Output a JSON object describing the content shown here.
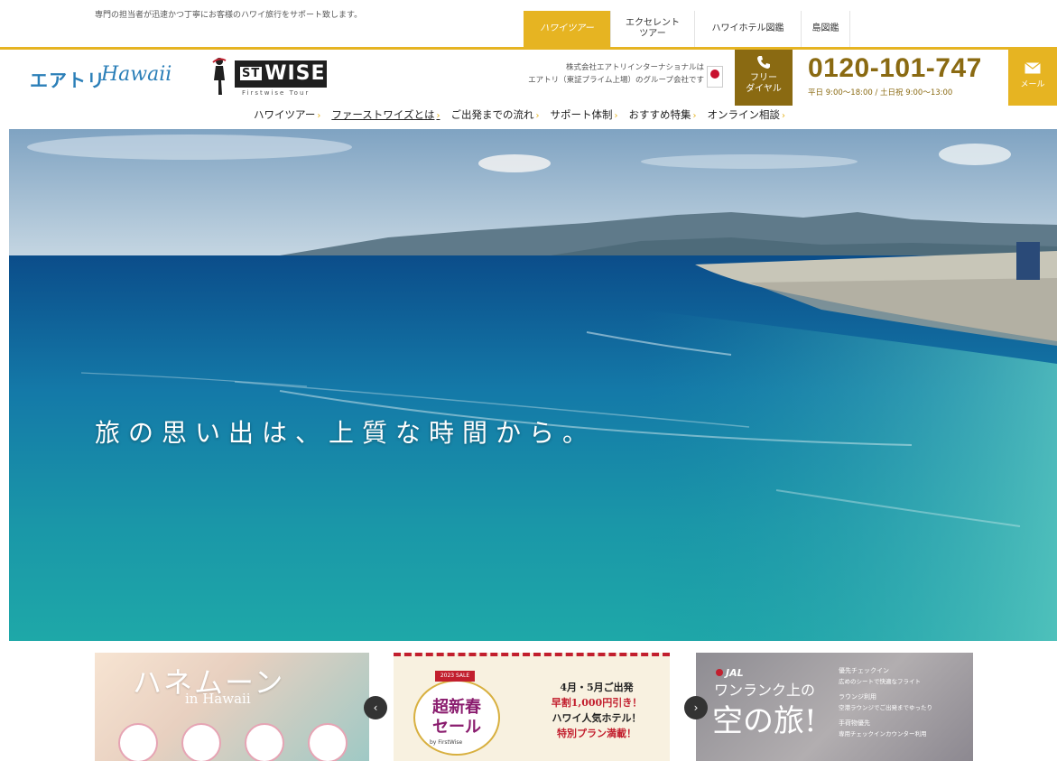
{
  "topbar": {
    "tagline": "専門の担当者が迅速かつ丁寧にお客様のハワイ旅行をサポート致します。",
    "tabs": [
      {
        "label": "ハワイツアー",
        "active": true
      },
      {
        "label": "エクセレント\nツアー",
        "active": false
      },
      {
        "label": "ハワイホテル図鑑",
        "active": false
      },
      {
        "label": "島図鑑",
        "active": false
      }
    ]
  },
  "header": {
    "brand": {
      "text_a": "エアトリ",
      "text_b": "Hawaii"
    },
    "logo2": {
      "st": "ST",
      "wise": "WISE",
      "sub": "Firstwise Tour"
    },
    "company_line1": "株式会社エアトリインターナショナルは",
    "company_line2": "エアトリ（東証プライム上場）のグループ会社です",
    "freedial_label": "フリー\nダイヤル",
    "phone": "0120-101-747",
    "hours": "平日 9:00〜18:00 / 土日祝 9:00〜13:00",
    "mail_label": "メール"
  },
  "mainnav": [
    {
      "label": "ハワイツアー",
      "active": false
    },
    {
      "label": "ファーストワイズとは",
      "active": true
    },
    {
      "label": "ご出発までの流れ",
      "active": false
    },
    {
      "label": "サポート体制",
      "active": false
    },
    {
      "label": "おすすめ特集",
      "active": false
    },
    {
      "label": "オンライン相談",
      "active": false
    }
  ],
  "hero": {
    "copy": "旅の思い出は、上質な時間から。"
  },
  "carousel": {
    "prev": "‹",
    "next": "›",
    "banner1": {
      "title": "ハネムーン",
      "sub": "in Hawaii"
    },
    "banner2": {
      "tag": "2023 SALE",
      "main": "超新春\nセール",
      "note": "by FirstWise",
      "line1": "4月・5月ご出発",
      "line2": "早割1,000円引き！",
      "line3": "ハワイ人気ホテル！",
      "line4": "特別プラン満載！"
    },
    "banner3": {
      "logo": "JAL",
      "title": "ワンランク上の",
      "big": "空の旅!",
      "items": [
        {
          "head": "優先チェックイン",
          "text": "広めのシートで快適なフライト"
        },
        {
          "head": "ラウンジ利用",
          "text": "空港ラウンジでご出発までゆったり"
        },
        {
          "head": "手荷物優先",
          "text": "専用チェックインカウンター利用"
        }
      ]
    }
  },
  "colors": {
    "gold": "#e6b422",
    "brown": "#8a6a12",
    "brand_blue": "#2b7fb8"
  }
}
